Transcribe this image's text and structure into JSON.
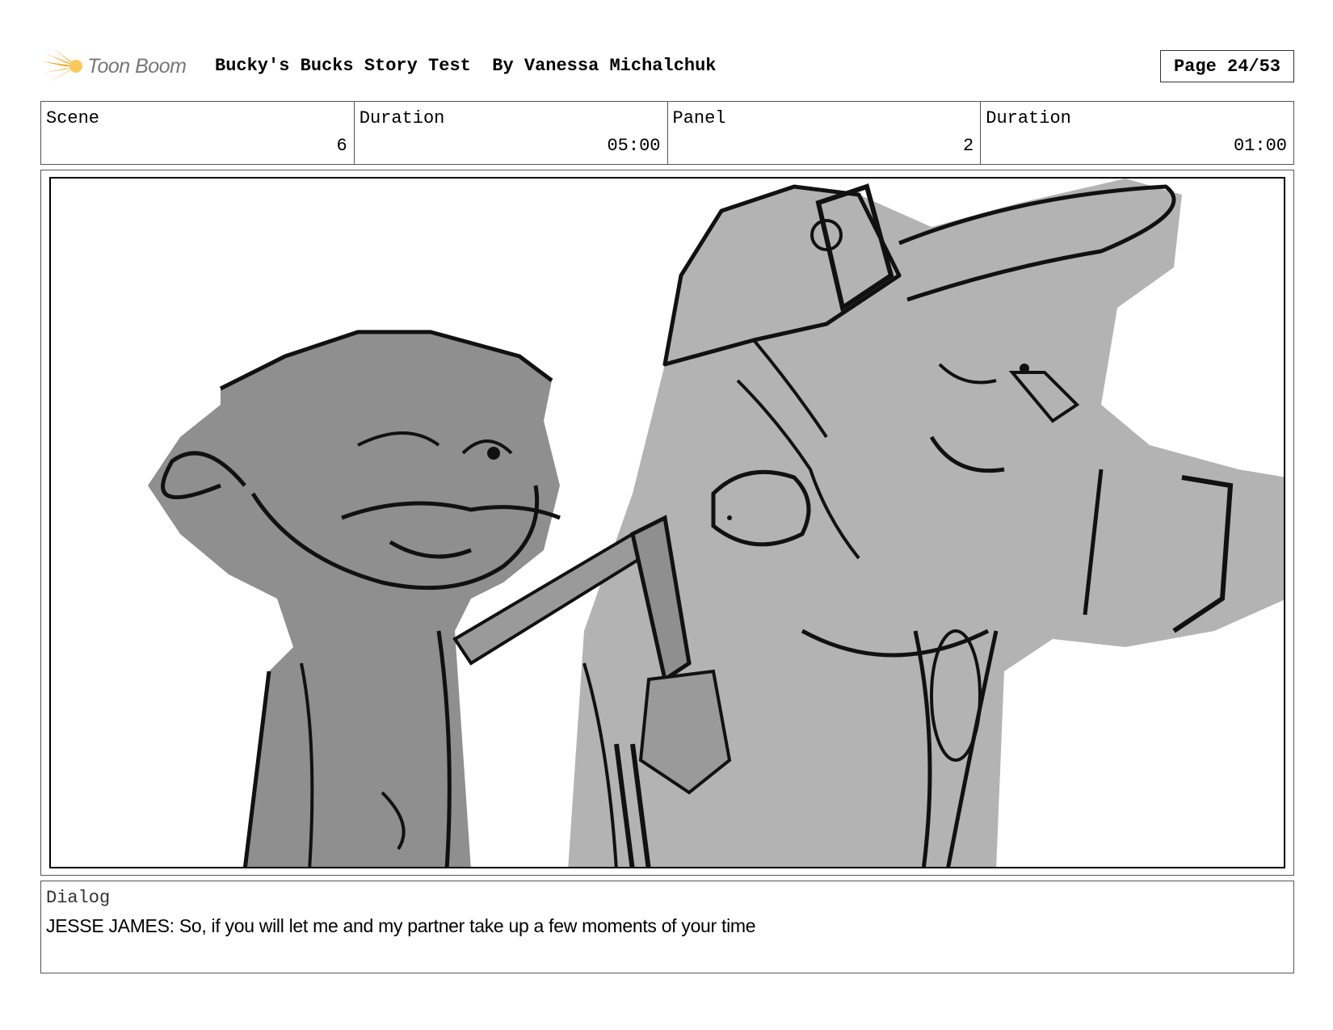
{
  "header": {
    "logo_text": "Toon Boom",
    "logo_icon": "starburst-logo-icon",
    "title": "Bucky's Bucks Story Test  By Vanessa Michalchuk",
    "page": "Page 24/53"
  },
  "info": {
    "scene_label": "Scene",
    "scene_value": "6",
    "scene_duration_label": "Duration",
    "scene_duration_value": "05:00",
    "panel_label": "Panel",
    "panel_value": "2",
    "panel_duration_label": "Duration",
    "panel_duration_value": "01:00"
  },
  "panel": {
    "image": "storyboard-sketch-two-characters-grayscale"
  },
  "dialog": {
    "label": "Dialog",
    "text": "JESSE JAMES: So, if you will let me and my partner take up a few moments of your time"
  },
  "colors": {
    "logo_orange": "#f5a623",
    "character_gray_dark": "#8f8f8f",
    "character_gray_light": "#b3b3b3",
    "line": "#111111"
  }
}
